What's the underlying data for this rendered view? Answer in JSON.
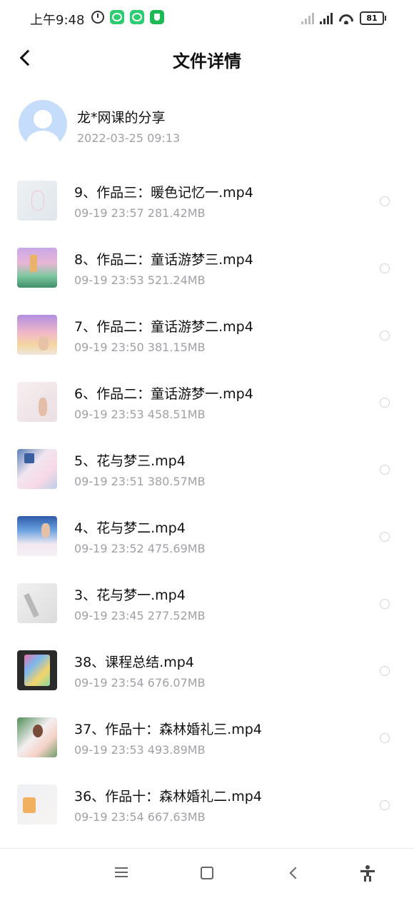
{
  "status_bar": {
    "time": "上午9:48",
    "battery": "81",
    "icons_left": [
      "alarm-icon",
      "wechat-icon",
      "wechat-icon",
      "shield-icon"
    ],
    "icons_right": [
      "signal-icon",
      "hd-signal-icon",
      "wifi-icon",
      "battery-icon"
    ]
  },
  "header": {
    "title": "文件详情"
  },
  "sharer": {
    "name": "龙*网课的分享",
    "date": "2022-03-25  09:13"
  },
  "files": [
    {
      "name": "9、作品三：暖色记忆一.mp4",
      "date": "09-19",
      "time": "23:57",
      "size": "281.42MB"
    },
    {
      "name": "8、作品二：童话游梦三.mp4",
      "date": "09-19",
      "time": "23:53",
      "size": "521.24MB"
    },
    {
      "name": "7、作品二：童话游梦二.mp4",
      "date": "09-19",
      "time": "23:50",
      "size": "381.15MB"
    },
    {
      "name": "6、作品二：童话游梦一.mp4",
      "date": "09-19",
      "time": "23:53",
      "size": "458.51MB"
    },
    {
      "name": "5、花与梦三.mp4",
      "date": "09-19",
      "time": "23:51",
      "size": "380.57MB"
    },
    {
      "name": "4、花与梦二.mp4",
      "date": "09-19",
      "time": "23:52",
      "size": "475.69MB"
    },
    {
      "name": "3、花与梦一.mp4",
      "date": "09-19",
      "time": "23:45",
      "size": "277.52MB"
    },
    {
      "name": "38、课程总结.mp4",
      "date": "09-19",
      "time": "23:54",
      "size": "676.07MB"
    },
    {
      "name": "37、作品十：森林婚礼三.mp4",
      "date": "09-19",
      "time": "23:53",
      "size": "493.89MB"
    },
    {
      "name": "36、作品十：森林婚礼二.mp4",
      "date": "09-19",
      "time": "23:54",
      "size": "667.63MB"
    }
  ],
  "nav_bar": {
    "icons": [
      "menu-icon",
      "home-icon",
      "back-icon",
      "accessibility-icon"
    ]
  }
}
